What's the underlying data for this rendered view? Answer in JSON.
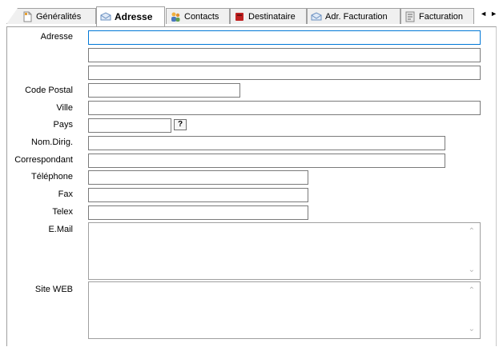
{
  "tabs": [
    {
      "label": "Généralités",
      "icon": "document-icon",
      "active": false
    },
    {
      "label": "Adresse",
      "icon": "envelope-icon",
      "active": true
    },
    {
      "label": "Contacts",
      "icon": "people-icon",
      "active": false
    },
    {
      "label": "Destinataire",
      "icon": "book-icon",
      "active": false
    },
    {
      "label": "Adr. Facturation",
      "icon": "envelope-icon",
      "active": false
    },
    {
      "label": "Facturation",
      "icon": "invoice-icon",
      "active": false
    }
  ],
  "tab_scroll": {
    "left": "◄",
    "right": "►"
  },
  "form": {
    "adresse_label": "Adresse",
    "adresse_line1": "",
    "adresse_line2": "",
    "adresse_line3": "",
    "code_postal_label": "Code Postal",
    "code_postal": "",
    "ville_label": "Ville",
    "ville": "",
    "pays_label": "Pays",
    "pays": "",
    "pays_lookup_label": "?",
    "nom_dirig_label": "Nom.Dirig.",
    "nom_dirig": "",
    "correspondant_label": "Correspondant",
    "correspondant": "",
    "telephone_label": "Téléphone",
    "telephone": "",
    "fax_label": "Fax",
    "fax": "",
    "telex_label": "Telex",
    "telex": "",
    "email_label": "E.Mail",
    "email": "",
    "site_web_label": "Site WEB",
    "site_web": ""
  },
  "colors": {
    "focus_border": "#0078d7",
    "field_border": "#7a7a7a",
    "tab_background": "#f0f0f0"
  }
}
